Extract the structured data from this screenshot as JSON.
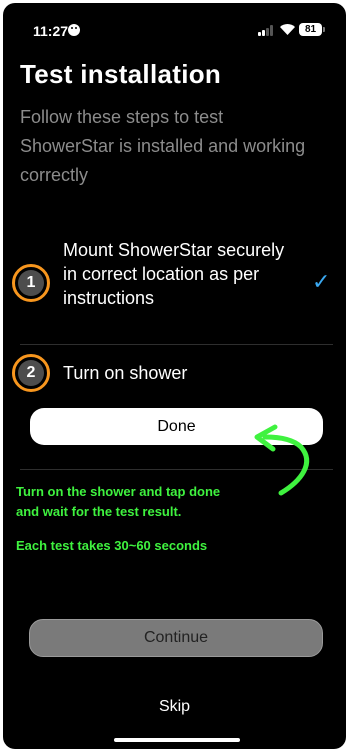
{
  "status_bar": {
    "time": "11:27",
    "battery": "81"
  },
  "header": {
    "title": "Test installation",
    "subtitle": "Follow these steps to test ShowerStar is installed and working correctly"
  },
  "steps": [
    {
      "number": "1",
      "text": "Mount ShowerStar securely in correct location as per instructions",
      "completed": true
    },
    {
      "number": "2",
      "text": "Turn on shower",
      "completed": false
    }
  ],
  "done_button": "Done",
  "annotation": {
    "line1": "Turn on the shower and tap done",
    "line2": "and wait for the test result.",
    "line3": "Each test takes 30~60 seconds"
  },
  "continue_button": "Continue",
  "skip_link": "Skip",
  "colors": {
    "accent_orange": "#f7961e",
    "check_blue": "#3aa8f0",
    "annotation_green": "#3ff23f"
  },
  "icons": {
    "check": "checkmark-icon",
    "arrow": "curved-arrow-icon"
  }
}
